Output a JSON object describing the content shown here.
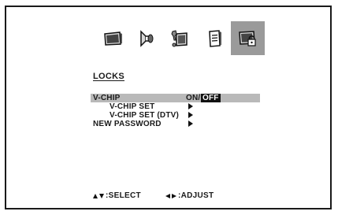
{
  "menu": {
    "icons": [
      {
        "name": "picture-icon",
        "active": false
      },
      {
        "name": "audio-icon",
        "active": false
      },
      {
        "name": "setup-icon",
        "active": false
      },
      {
        "name": "features-icon",
        "active": false
      },
      {
        "name": "locks-icon",
        "active": true
      }
    ],
    "title": "LOCKS",
    "items": [
      {
        "label": "V-CHIP",
        "value_on": "ON/",
        "value_off": "OFF",
        "selected": true
      },
      {
        "label": "V-CHIP SET",
        "has_submenu": true
      },
      {
        "label": "V-CHIP SET (DTV)",
        "has_submenu": true
      },
      {
        "label": "NEW PASSWORD",
        "has_submenu": true
      }
    ]
  },
  "footer": {
    "select_label": ":SELECT",
    "adjust_label": ":ADJUST"
  }
}
